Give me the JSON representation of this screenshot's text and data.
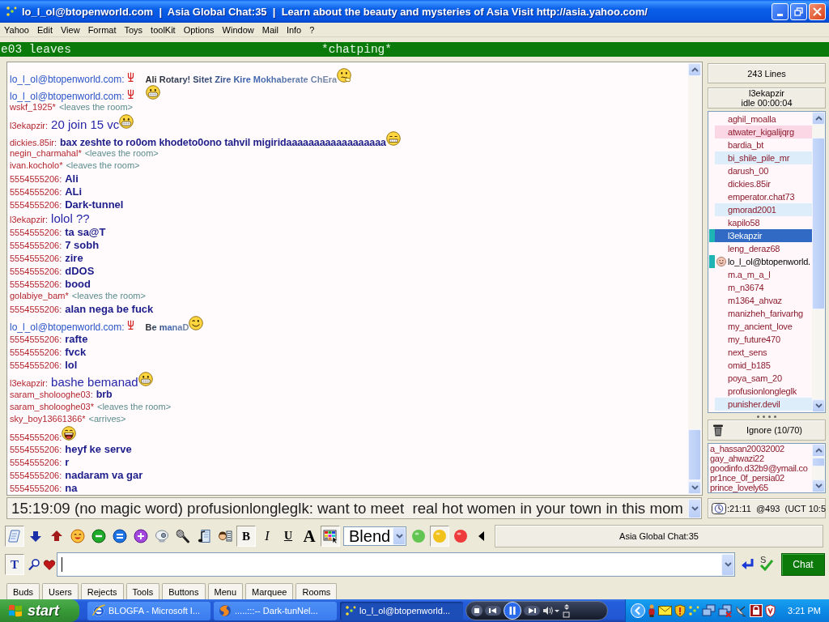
{
  "window": {
    "title": "lo_l_ol@btopenworld.com  |  Asia Global Chat:35  |  Learn about the beauty and mysteries of Asia Visit http://asia.yahoo.com/"
  },
  "menu": [
    "Yahoo",
    "Edit",
    "View",
    "Format",
    "Toys",
    "toolKit",
    "Options",
    "Window",
    "Mail",
    "Info",
    "?"
  ],
  "marquee": {
    "left": "e03 leaves",
    "center": "*chatping*"
  },
  "chat": {
    "lines": [
      {
        "kind": "self",
        "nick": "lo_l_ol@btopenworld.com:",
        "text": "Ali Rotary! Sitet Zire Kire Mokhaberate ChEra",
        "emoticon": {
          "kind": "thinking"
        }
      },
      {
        "kind": "self",
        "nick": "lo_l_ol@btopenworld.com:",
        "emoticon": {
          "kind": "grin"
        }
      },
      {
        "kind": "event",
        "nick": "wskf_1925*",
        "text": "<leaves the room>"
      },
      {
        "kind": "large",
        "nick": "l3ekapzir:",
        "text": "20 join 15 vc",
        "emoticon": {
          "kind": "grin"
        }
      },
      {
        "kind": "plain",
        "nick": "dickies.85ir:",
        "text": "bax zeshte to ro0om khodeto0ono tahvil migiridaaaaaaaaaaaaaaaaaa",
        "emoticon": {
          "kind": "grimace"
        }
      },
      {
        "kind": "event",
        "nick": "negin_charmahal*",
        "text": "<leaves the room>"
      },
      {
        "kind": "event",
        "nick": "ivan.kocholo*",
        "text": "<leaves the room>"
      },
      {
        "kind": "bold",
        "nick": "5554555206:",
        "text": "Ali"
      },
      {
        "kind": "bold",
        "nick": "5554555206:",
        "text": "ALi"
      },
      {
        "kind": "bold",
        "nick": "5554555206:",
        "text": "Dark-tunnel"
      },
      {
        "kind": "large",
        "nick": "l3ekapzir:",
        "text": "lolol ??"
      },
      {
        "kind": "bold",
        "nick": "5554555206:",
        "text": "ta sa@T"
      },
      {
        "kind": "bold",
        "nick": "5554555206:",
        "text": "7 sobh"
      },
      {
        "kind": "bold",
        "nick": "5554555206:",
        "text": "zire"
      },
      {
        "kind": "bold",
        "nick": "5554555206:",
        "text": "dDOS"
      },
      {
        "kind": "bold",
        "nick": "5554555206:",
        "text": "bood"
      },
      {
        "kind": "event",
        "nick": "golabiye_bam*",
        "text": "<leaves the room>"
      },
      {
        "kind": "bold",
        "nick": "5554555206:",
        "text": "alan nega be fuck"
      },
      {
        "kind": "self",
        "nick": "lo_l_ol@btopenworld.com:",
        "text": "Be manaD",
        "emoticon": {
          "kind": "wink"
        }
      },
      {
        "kind": "bold",
        "nick": "5554555206:",
        "text": "rafte"
      },
      {
        "kind": "bold",
        "nick": "5554555206:",
        "text": "fvck"
      },
      {
        "kind": "bold",
        "nick": "5554555206:",
        "text": "lol"
      },
      {
        "kind": "large",
        "nick": "l3ekapzir:",
        "text": "bashe bemanad",
        "emoticon": {
          "kind": "grin"
        }
      },
      {
        "kind": "plain",
        "nick": "saram_sholooghe03:",
        "text": "brb"
      },
      {
        "kind": "event",
        "nick": "saram_sholooghe03*",
        "text": "<leaves the room>"
      },
      {
        "kind": "event",
        "nick": "sky_boy13661366*",
        "text": "<arrives>"
      },
      {
        "kind": "bold",
        "nick": "5554555206:",
        "emoticon": {
          "kind": "laugh"
        }
      },
      {
        "kind": "bold",
        "nick": "5554555206:",
        "text": "heyf ke serve"
      },
      {
        "kind": "bold",
        "nick": "5554555206:",
        "text": "r"
      },
      {
        "kind": "bold",
        "nick": "5554555206:",
        "text": "nadaram va gar"
      },
      {
        "kind": "bold",
        "nick": "5554555206:",
        "text": "na"
      }
    ]
  },
  "user_panel": {
    "line_count": "243 Lines",
    "current_user": "l3ekapzir",
    "idle": "idle 00:00:04",
    "users": [
      {
        "name": "aghil_moalla",
        "kind": "user",
        "marked": false,
        "selected": false
      },
      {
        "name": "atwater_kigalijqrg",
        "kind": "user",
        "marked": false,
        "selected": false,
        "color": "#fbd6e5"
      },
      {
        "name": "bardia_bt",
        "kind": "user",
        "marked": false,
        "selected": false
      },
      {
        "name": "bi_shile_pile_mr",
        "kind": "user",
        "marked": false,
        "selected": false,
        "color": "#ddedfa"
      },
      {
        "name": "darush_00",
        "kind": "user",
        "marked": false,
        "selected": false
      },
      {
        "name": "dickies.85ir",
        "kind": "user",
        "marked": false,
        "selected": false
      },
      {
        "name": "emperator.chat73",
        "kind": "user",
        "marked": false,
        "selected": false
      },
      {
        "name": "gmorad2001",
        "kind": "user",
        "marked": false,
        "selected": false,
        "color": "#ddedfa"
      },
      {
        "name": "kapilo58",
        "kind": "user",
        "marked": false,
        "selected": false
      },
      {
        "name": "l3ekapzir",
        "kind": "user",
        "marked": true,
        "selected": true
      },
      {
        "name": "leng_deraz68",
        "kind": "user",
        "marked": false,
        "selected": false
      },
      {
        "name": "lo_l_ol@btopenworld.",
        "kind": "self",
        "marked": true,
        "selected": false
      },
      {
        "name": "m.a_m_a_l",
        "kind": "user",
        "marked": false,
        "selected": false
      },
      {
        "name": "m_n3674",
        "kind": "user",
        "marked": false,
        "selected": false
      },
      {
        "name": "m1364_ahvaz",
        "kind": "user",
        "marked": false,
        "selected": false
      },
      {
        "name": "manizheh_farivarhg",
        "kind": "user",
        "marked": false,
        "selected": false
      },
      {
        "name": "my_ancient_love",
        "kind": "user",
        "marked": false,
        "selected": false
      },
      {
        "name": "my_future470",
        "kind": "user",
        "marked": false,
        "selected": false
      },
      {
        "name": "next_sens",
        "kind": "user",
        "marked": false,
        "selected": false
      },
      {
        "name": "omid_b185",
        "kind": "user",
        "marked": false,
        "selected": false
      },
      {
        "name": "poya_sam_20",
        "kind": "user",
        "marked": false,
        "selected": false
      },
      {
        "name": "profusionlongleglk",
        "kind": "user",
        "marked": false,
        "selected": false
      },
      {
        "name": "punisher.devil",
        "kind": "user",
        "marked": false,
        "selected": false,
        "color": "#ddedfa"
      }
    ],
    "ignore_button": "Ignore (10/70)",
    "ignored": [
      "a_hassan20032002",
      "gay_ahwazi22",
      "goodinfo.d32b9@ymail.co",
      "pr1nce_0f_persia02",
      "prince_lovely65"
    ]
  },
  "status_line": {
    "value": "15:19:09 (no magic word) profusionlongleglk: want to meet  real hot women in your town in this mom"
  },
  "clock_panel": {
    "text": ":21:11  @493  (UCT 10:5"
  },
  "toolbar": {
    "items": [
      {
        "kind": "scroll",
        "pressed": true
      },
      {
        "kind": "arrow-down",
        "pressed": false
      },
      {
        "kind": "arrow-up",
        "pressed": false
      },
      {
        "kind": "smiley",
        "pressed": false
      },
      {
        "kind": "minus",
        "pressed": false
      },
      {
        "kind": "equals",
        "pressed": false
      },
      {
        "kind": "plus",
        "pressed": false
      },
      {
        "kind": "webcam",
        "pressed": false
      },
      {
        "kind": "microphone",
        "pressed": false
      },
      {
        "kind": "music",
        "pressed": false
      },
      {
        "kind": "person-list",
        "pressed": false
      },
      {
        "kind": "bold",
        "label": "B",
        "pressed": true
      },
      {
        "kind": "italic",
        "label": "I",
        "pressed": false
      },
      {
        "kind": "underline",
        "label": "U",
        "pressed": false
      },
      {
        "kind": "font",
        "label": "A",
        "pressed": false
      },
      {
        "kind": "color-grid",
        "pressed": true
      },
      {
        "kind": "select",
        "value": "Blend"
      },
      {
        "kind": "light",
        "color": "#62c552",
        "pressed": false
      },
      {
        "kind": "light",
        "color": "#f2c21c",
        "pressed": true
      },
      {
        "kind": "light",
        "color": "#ee3a3a",
        "pressed": false
      },
      {
        "kind": "caret-left",
        "pressed": false
      }
    ],
    "room": "Asia Global Chat:35"
  },
  "input_bar": {
    "tools": [
      {
        "kind": "text",
        "label": "T",
        "pressed": true
      },
      {
        "kind": "search",
        "pressed": false
      },
      {
        "kind": "heart",
        "pressed": false
      }
    ],
    "spell_label": "S",
    "send_button": "Chat"
  },
  "tabs": [
    {
      "label": "Buds",
      "selected": false
    },
    {
      "label": "Users",
      "selected": false
    },
    {
      "label": "Rejects",
      "selected": false
    },
    {
      "label": "Tools",
      "selected": false
    },
    {
      "label": "Buttons",
      "selected": false
    },
    {
      "label": "Menu",
      "selected": false
    },
    {
      "label": "Marquee",
      "selected": false
    },
    {
      "label": "Rooms",
      "selected": false
    }
  ],
  "taskbar": {
    "start": "start",
    "tasks": [
      {
        "kind": "browser",
        "label": "BLOGFA - Microsoft I...",
        "selected": false
      },
      {
        "kind": "globe",
        "label": ".....:::-- Dark-tunNel...",
        "selected": false
      },
      {
        "kind": "messenger",
        "label": "lo_l_ol@btopenworld...",
        "selected": true
      }
    ],
    "clock": "3:21 PM"
  }
}
